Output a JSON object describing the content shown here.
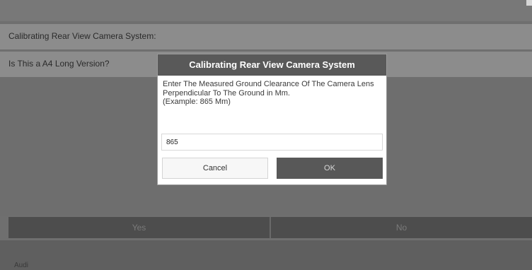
{
  "header": {
    "title": "Calibrating Rear View Camera System:",
    "question": "Is This a A4 Long Version?"
  },
  "bottom_buttons": {
    "yes_label": "Yes",
    "no_label": "No"
  },
  "footer": {
    "brand": "Audi"
  },
  "dialog": {
    "title": "Calibrating Rear View Camera System",
    "message_line1": "Enter The Measured Ground Clearance Of The Camera Lens Perpendicular To The Ground in Mm.",
    "message_line2": "(Example: 865 Mm)",
    "input_value": "865",
    "cancel_label": "Cancel",
    "ok_label": "OK"
  },
  "colors": {
    "dialog_title_bg": "#595959",
    "ok_button_bg": "#585858",
    "overlay_bg": "#6f6f6f"
  }
}
